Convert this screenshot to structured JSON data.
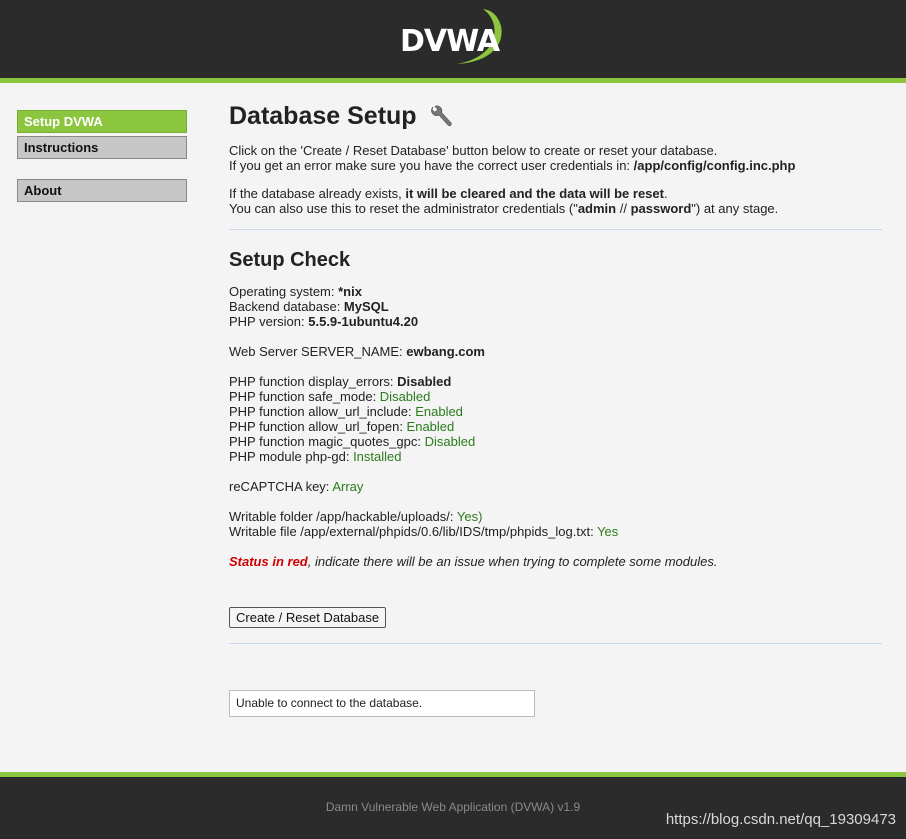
{
  "header": {
    "logo_text": "DVWA"
  },
  "sidebar": {
    "items": [
      {
        "label": "Setup DVWA",
        "active": true
      },
      {
        "label": "Instructions",
        "active": false
      },
      {
        "label": "About",
        "active": false
      }
    ]
  },
  "main": {
    "title": "Database Setup",
    "intro": {
      "line1": "Click on the 'Create / Reset Database' button below to create or reset your database.",
      "line2_prefix": "If you get an error make sure you have the correct user credentials in: ",
      "config_path": "/app/config/config.inc.php",
      "line3_prefix": "If the database already exists, ",
      "line3_bold": "it will be cleared and the data will be reset",
      "line3_suffix": ".",
      "line4_prefix": "You can also use this to reset the administrator credentials (\"",
      "admin": "admin",
      "sep": " // ",
      "password": "password",
      "line4_suffix": "\") at any stage."
    },
    "setup_check": {
      "title": "Setup Check",
      "os_label": "Operating system: ",
      "os_value": "*nix",
      "db_label": "Backend database: ",
      "db_value": "MySQL",
      "php_label": "PHP version: ",
      "php_value": "5.5.9-1ubuntu4.20",
      "server_label": "Web Server SERVER_NAME: ",
      "server_value": "ewbang.com",
      "display_errors_label": "PHP function display_errors: ",
      "display_errors_value": "Disabled",
      "safe_mode_label": "PHP function safe_mode: ",
      "safe_mode_value": "Disabled",
      "url_include_label": "PHP function allow_url_include: ",
      "url_include_value": "Enabled",
      "url_fopen_label": "PHP function allow_url_fopen: ",
      "url_fopen_value": "Enabled",
      "magic_quotes_label": "PHP function magic_quotes_gpc: ",
      "magic_quotes_value": "Disabled",
      "php_gd_label": "PHP module php-gd: ",
      "php_gd_value": "Installed",
      "recaptcha_label": "reCAPTCHA key: ",
      "recaptcha_value": "Array",
      "uploads_label": "Writable folder /app/hackable/uploads/: ",
      "uploads_value": "Yes)",
      "phpids_label": "Writable file /app/external/phpids/0.6/lib/IDS/tmp/phpids_log.txt: ",
      "phpids_value": "Yes",
      "status_red": "Status in red",
      "status_suffix": ", indicate there will be an issue when trying to complete some modules."
    },
    "create_button": "Create / Reset Database",
    "message": "Unable to connect to the database."
  },
  "footer": {
    "text": "Damn Vulnerable Web Application (DVWA) v1.9",
    "watermark": "https://blog.csdn.net/qq_19309473"
  },
  "colors": {
    "accent_green": "#8cc63f",
    "header_bg": "#2b2b2b",
    "ok_green": "#2a7b1c",
    "error_red": "#d00000"
  }
}
